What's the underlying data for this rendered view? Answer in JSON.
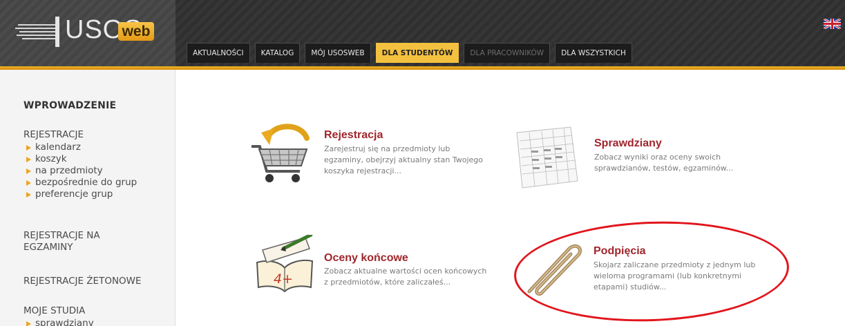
{
  "header": {
    "logo_text": "USOS",
    "logo_badge": "web",
    "language_flag": "uk-flag-icon",
    "tabs": [
      {
        "label": "AKTUALNOŚCI",
        "state": "normal"
      },
      {
        "label": "KATALOG",
        "state": "normal"
      },
      {
        "label": "MÓJ USOSWEB",
        "state": "normal"
      },
      {
        "label": "DLA STUDENTÓW",
        "state": "active"
      },
      {
        "label": "DLA PRACOWNIKÓW",
        "state": "disabled"
      },
      {
        "label": "DLA WSZYSTKICH",
        "state": "normal"
      }
    ]
  },
  "sidebar": {
    "heading": "WPROWADZENIE",
    "sections": [
      {
        "label": "REJESTRACJE",
        "items": [
          "kalendarz",
          "koszyk",
          "na przedmioty",
          "bezpośrednie do grup",
          "preferencje grup"
        ]
      },
      {
        "label_line1": "REJESTRACJE NA",
        "label_line2": "EGZAMINY"
      },
      {
        "label": "REJESTRACJE ŻETONOWE"
      },
      {
        "label": "MOJE STUDIA",
        "items": [
          "sprawdziany"
        ]
      }
    ]
  },
  "main": {
    "items": [
      {
        "title": "Rejestracja",
        "icon": "shopping-cart-icon",
        "desc": [
          "Zarejestruj się na przedmioty lub",
          "egzaminy, obejrzyj aktualny stan Twojego",
          "koszyka rejestracji..."
        ]
      },
      {
        "title": "Sprawdziany",
        "icon": "spreadsheet-icon",
        "desc": [
          "Zobacz wyniki oraz oceny swoich",
          "sprawdzianów, testów, egzaminów..."
        ]
      },
      {
        "title": "Oceny końcowe",
        "icon": "gradebook-icon",
        "grade": "4+",
        "desc": [
          "Zobacz aktualne wartości ocen końcowych",
          "z przedmiotów, które zaliczałeś..."
        ]
      },
      {
        "title": "Podpięcia",
        "icon": "paperclip-icon",
        "desc": [
          "Skojarz zaliczane przedmioty z jednym lub",
          "wieloma programami (lub konkretnymi",
          "etapami) studiów..."
        ]
      }
    ],
    "highlight_color": "#e2141c"
  }
}
